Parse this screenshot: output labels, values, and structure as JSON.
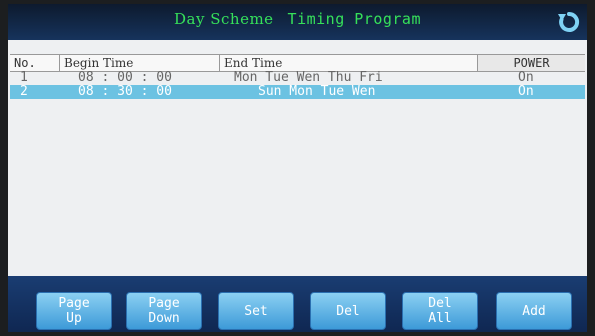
{
  "header": {
    "title_part1": "Day Scheme",
    "title_part2": "Timing Program",
    "back_icon": "refresh-back-icon"
  },
  "table": {
    "columns": [
      "No.",
      "Begin Time",
      "End Time",
      "POWER"
    ],
    "rows": [
      {
        "no": "1",
        "begin": "08 : 00 : 00",
        "end": "Mon Tue Wen Thu Fri",
        "power": "On",
        "selected": false
      },
      {
        "no": "2",
        "begin": "08 : 30 : 00",
        "end": "Sun Mon Tue Wen",
        "power": "On",
        "selected": true
      }
    ]
  },
  "buttons": {
    "page_up_l1": "Page",
    "page_up_l2": "Up",
    "page_down_l1": "Page",
    "page_down_l2": "Down",
    "set": "Set",
    "del": "Del",
    "del_all_l1": "Del",
    "del_all_l2": "All",
    "add": "Add"
  },
  "colors": {
    "title_text": "#36e05a",
    "selected_row": "#6cc2e2",
    "button": "#5ab4e8",
    "bars": "#16335c"
  }
}
